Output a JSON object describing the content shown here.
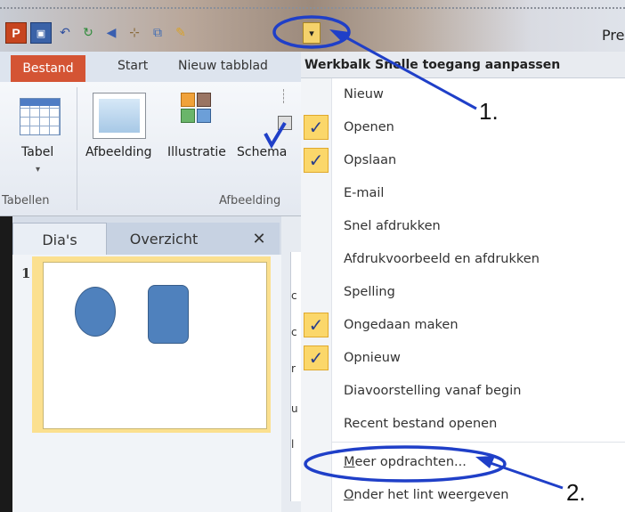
{
  "titlebar": {
    "app_title": "Pres",
    "qat_dropdown_glyph": "▾"
  },
  "ribbon": {
    "tabs": {
      "file": "Bestand",
      "start": "Start",
      "new_tab": "Nieuw tabblad"
    },
    "buttons": {
      "table": "Tabel",
      "table_arrow": "▾",
      "picture": "Afbeelding",
      "illustration": "Illustratie",
      "schema": "Schema"
    },
    "groups": {
      "tables": "Tabellen",
      "pictures": "Afbeelding"
    }
  },
  "slides_pane": {
    "tabs": [
      "Dia's",
      "Overzicht"
    ],
    "close_glyph": "✕",
    "slide_number": "1"
  },
  "menu": {
    "header": "Werkbalk Snelle toegang aanpassen",
    "items": [
      {
        "label": "Nieuw",
        "checked": false
      },
      {
        "label": "Openen",
        "checked": true
      },
      {
        "label": "Opslaan",
        "checked": true
      },
      {
        "label": "E-mail",
        "checked": false
      },
      {
        "label": "Snel afdrukken",
        "checked": false
      },
      {
        "label": "Afdrukvoorbeeld en afdrukken",
        "checked": false
      },
      {
        "label": "Spelling",
        "checked": false
      },
      {
        "label": "Ongedaan maken",
        "checked": true
      },
      {
        "label": "Opnieuw",
        "checked": true
      },
      {
        "label": "Diavoorstelling vanaf begin",
        "checked": false
      },
      {
        "label": "Recent bestand openen",
        "checked": false
      }
    ],
    "more_commands": {
      "mnemonic": "M",
      "rest": "eer opdrachten..."
    },
    "show_below": {
      "mnemonic": "O",
      "rest": "nder het lint weergeven"
    },
    "check_glyph": "✓"
  },
  "annotations": {
    "step1": "1.",
    "step2": "2."
  },
  "colors": {
    "file_tab": "#d45434",
    "check_bg": "#fbd76a",
    "annotation_blue": "#1f3fc8",
    "shape_fill": "#4f81bd"
  }
}
